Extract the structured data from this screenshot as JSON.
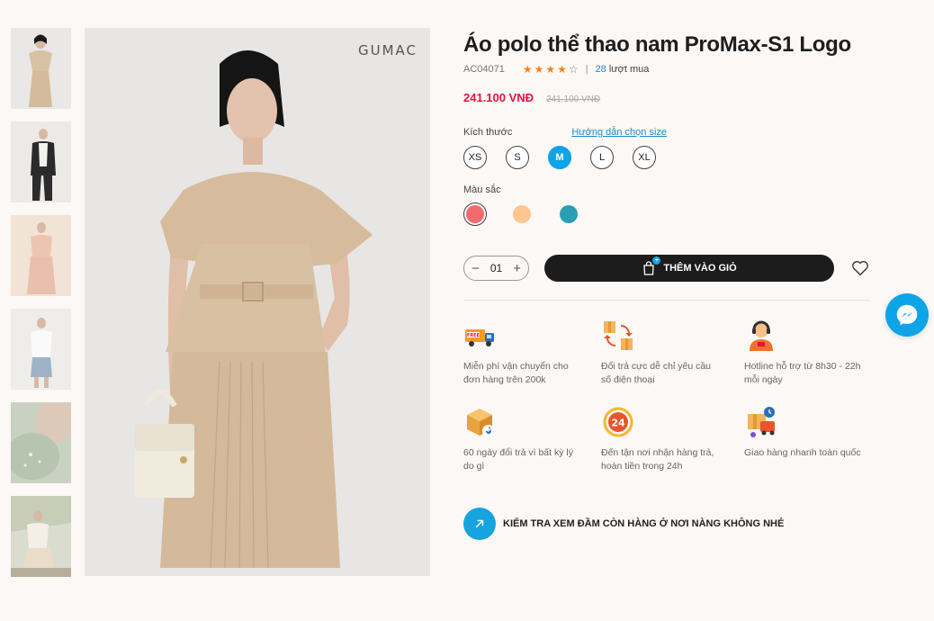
{
  "gallery": {
    "brand": "GUMAC",
    "thumbnails": [
      {
        "id": "thumb-1"
      },
      {
        "id": "thumb-2"
      },
      {
        "id": "thumb-3"
      },
      {
        "id": "thumb-4"
      },
      {
        "id": "thumb-5"
      },
      {
        "id": "thumb-6"
      }
    ]
  },
  "product": {
    "title": "Áo polo thể thao nam ProMax-S1 Logo",
    "sku": "AC04071",
    "rating": 4,
    "rating_max": 5,
    "review_count": "28",
    "review_label": "lượt mua",
    "price": "241.100 VNĐ",
    "old_price": "241.100 VNĐ"
  },
  "size": {
    "label": "Kích thước",
    "guide_link": "Hướng dẫn chọn size",
    "options": [
      "XS",
      "S",
      "M",
      "L",
      "XL"
    ],
    "selected": "M"
  },
  "color": {
    "label": "Màu sắc",
    "options": [
      "#f36b6e",
      "#ffc68f",
      "#2a9fb3"
    ],
    "selected_index": 0
  },
  "cart": {
    "quantity": "01",
    "minus": "−",
    "plus": "+",
    "add_label": "THÊM VÀO GIỎ",
    "badge": "+"
  },
  "features": [
    {
      "icon": "free-shipping-truck-icon",
      "text": "Miễn phí vận chuyển cho đơn hàng trên 200k"
    },
    {
      "icon": "exchange-boxes-icon",
      "text": "Đổi trả cực dễ chỉ yêu cầu số điện thoại"
    },
    {
      "icon": "hotline-support-icon",
      "text": "Hotline hỗ trợ từ 8h30 - 22h mỗi ngày"
    },
    {
      "icon": "return-box-icon",
      "text": "60 ngày đổi trả vì bất kỳ lý do gì"
    },
    {
      "icon": "24h-icon",
      "text": "Đến tận nơi nhận hàng trả, hoàn tiền trong 24h"
    },
    {
      "icon": "fast-delivery-icon",
      "text": "Giao hàng nhanh toàn quốc"
    }
  ],
  "stock_check": {
    "label": "KIỂM TRA XEM ĐẦM CÒN HÀNG Ở NƠI NÀNG KHÔNG NHÉ"
  },
  "colors": {
    "accent": "#0fa4e6",
    "price": "#e4123c",
    "star": "#f5841f",
    "button": "#1c1c1c",
    "background": "#fbf8f6"
  }
}
